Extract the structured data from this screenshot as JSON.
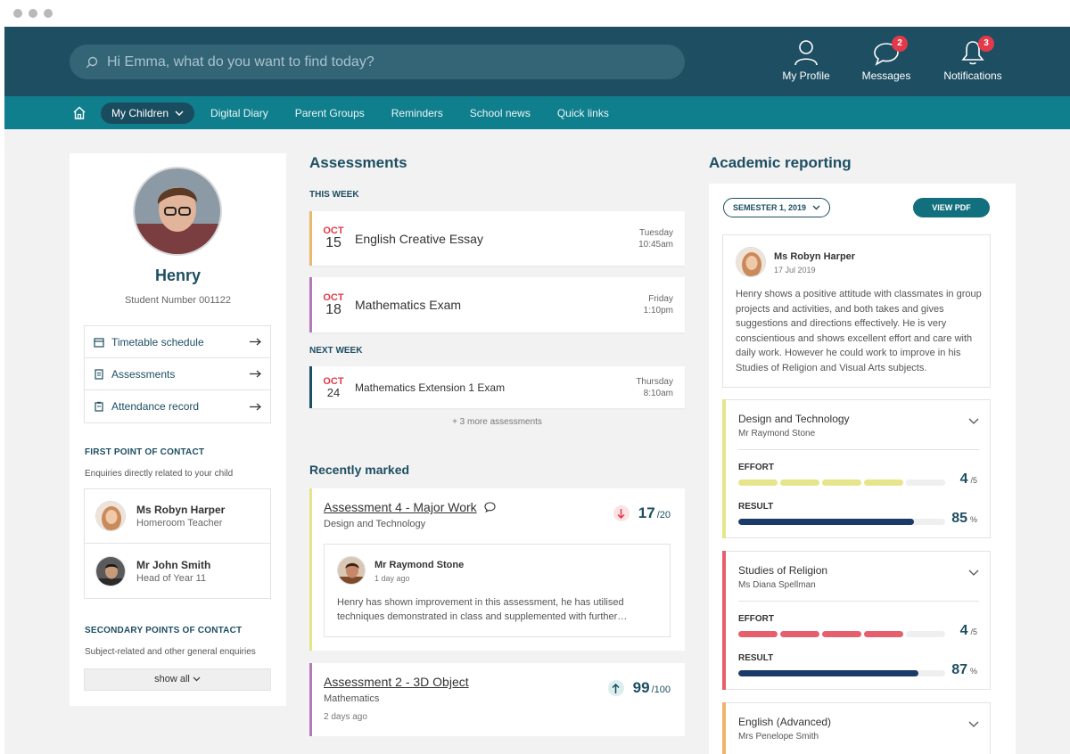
{
  "search": {
    "placeholder": "Hi Emma, what do you want to find today?"
  },
  "top_icons": [
    {
      "label": "My Profile",
      "badge": ""
    },
    {
      "label": "Messages",
      "badge": "2"
    },
    {
      "label": "Notifications",
      "badge": "3"
    }
  ],
  "nav": {
    "pill": "My Children",
    "items": [
      "Digital Diary",
      "Parent Groups",
      "Reminders",
      "School news",
      "Quick links"
    ]
  },
  "student": {
    "name": "Henry",
    "number": "Student Number 001122",
    "links": [
      "Timetable schedule",
      "Assessments",
      "Attendance record"
    ],
    "first_contact_head": "FIRST POINT OF CONTACT",
    "first_contact_sub": "Enquiries directly related to your child",
    "contacts": [
      {
        "name": "Ms Robyn Harper",
        "role": "Homeroom Teacher"
      },
      {
        "name": "Mr John Smith",
        "role": "Head of Year 11"
      }
    ],
    "secondary_head": "SECONDARY POINTS OF CONTACT",
    "secondary_sub": "Subject-related and other general enquiries",
    "show_all": "show all"
  },
  "assessments": {
    "title": "Assessments",
    "this_week": "THIS WEEK",
    "next_week": "NEXT WEEK",
    "items": [
      {
        "month": "OCT",
        "day": "15",
        "title": "English Creative Essay",
        "weekday": "Tuesday",
        "time": "10:45am",
        "color": "#e8b96a"
      },
      {
        "month": "OCT",
        "day": "18",
        "title": "Mathematics Exam",
        "weekday": "Friday",
        "time": "1:10pm",
        "color": "#b47ab8"
      },
      {
        "month": "OCT",
        "day": "24",
        "title": "Mathematics Extension 1 Exam",
        "weekday": "Thursday",
        "time": "8:10am",
        "color": "#1d4e62"
      }
    ],
    "more": "+ 3 more assessments"
  },
  "recently_marked": {
    "title": "Recently marked",
    "items": [
      {
        "name": "Assessment 4 - Major Work",
        "subject": "Design and Technology",
        "score": "17",
        "out_of": "/20",
        "trend": "down",
        "feedback": {
          "name": "Mr Raymond Stone",
          "time": "1 day ago",
          "text": "Henry has shown improvement in this assessment, he has utilised techniques demonstrated in class and supplemented with further…"
        }
      },
      {
        "name": "Assessment 2 - 3D Object",
        "subject": "Mathematics",
        "time": "2 days ago",
        "score": "99",
        "out_of": "/100",
        "trend": "up"
      }
    ]
  },
  "academic": {
    "title": "Academic reporting",
    "semester": "SEMESTER 1, 2019",
    "view_pdf": "VIEW PDF",
    "report": {
      "name": "Ms Robyn Harper",
      "date": "17 Jul 2019",
      "text": "Henry shows a positive attitude with classmates in group projects and activities, and both takes and gives suggestions and directions effectively. He is very conscientious and shows excellent effort and care with daily work. However he could work to improve in his Studies of Religion and Visual Arts subjects."
    },
    "effort_label": "EFFORT",
    "result_label": "RESULT",
    "subjects": [
      {
        "name": "Design and Technology",
        "teacher": "Mr Raymond Stone",
        "effort": "4",
        "effort_of": "/5",
        "result": "85",
        "result_unit": "%",
        "color": "#e6e58b",
        "effort_value": 4,
        "result_value": 85
      },
      {
        "name": "Studies of Religion",
        "teacher": "Ms Diana Spellman",
        "effort": "4",
        "effort_of": "/5",
        "result": "87",
        "result_unit": "%",
        "color": "#e5606c",
        "effort_value": 4,
        "result_value": 87
      },
      {
        "name": "English (Advanced)",
        "teacher": "Mrs Penelope Smith",
        "color": "#f0b36a"
      }
    ]
  }
}
